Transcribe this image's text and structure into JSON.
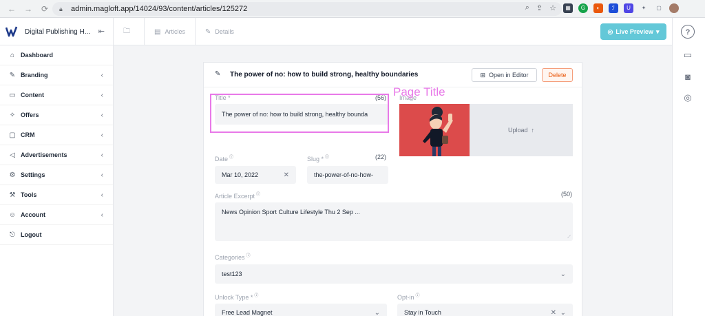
{
  "browser": {
    "url": "admin.magloft.app/14024/93/content/articles/125272",
    "nav": [
      "←",
      "→",
      "⟳"
    ],
    "extensions": [
      {
        "label": "▦",
        "color": "#374151"
      },
      {
        "label": "G",
        "color": "#16a34a"
      },
      {
        "label": "◐",
        "color": "#ea580c"
      },
      {
        "label": "ℐ",
        "color": "#1d4ed8"
      },
      {
        "label": "U",
        "color": "#4f46e5"
      },
      {
        "label": "✦",
        "color": "#6b7280"
      },
      {
        "label": "▢",
        "color": "#6b7280"
      }
    ]
  },
  "app": {
    "brand_name": "Digital Publishing H...",
    "breadcrumbs": [
      {
        "label": ""
      },
      {
        "label": "Articles"
      },
      {
        "label": "Details"
      }
    ],
    "live_preview_label": "Live Preview"
  },
  "sidebar": {
    "items": [
      {
        "label": "Dashboard",
        "icon": "⌂",
        "chevron": ""
      },
      {
        "label": "Branding",
        "icon": "✎",
        "chevron": "‹"
      },
      {
        "label": "Content",
        "icon": "▭",
        "chevron": "‹"
      },
      {
        "label": "Offers",
        "icon": "✧",
        "chevron": "‹"
      },
      {
        "label": "CRM",
        "icon": "▢",
        "chevron": "‹"
      },
      {
        "label": "Advertisements",
        "icon": "◁",
        "chevron": "‹"
      },
      {
        "label": "Settings",
        "icon": "⚙",
        "chevron": "‹"
      },
      {
        "label": "Tools",
        "icon": "⚒",
        "chevron": "‹"
      },
      {
        "label": "Account",
        "icon": "☺",
        "chevron": "‹"
      },
      {
        "label": "Logout",
        "icon": "⎋",
        "chevron": ""
      }
    ]
  },
  "article": {
    "heading": "The power of no: how to build strong, healthy boundaries",
    "open_in_editor_label": "Open in Editor",
    "delete_label": "Delete",
    "title_label": "Title *",
    "title_count": "(56)",
    "title_value": "The power of no: how to build strong, healthy bounda",
    "image_label": "Image",
    "upload_label": "Upload",
    "date_label": "Date",
    "date_value": "Mar 10, 2022",
    "slug_label": "Slug *",
    "slug_count": "(22)",
    "slug_value": "the-power-of-no-how-",
    "excerpt_label": "Article Excerpt",
    "excerpt_count": "(50)",
    "excerpt_value": "News Opinion Sport Culture Lifestyle Thu 2 Sep ...",
    "categories_label": "Categories",
    "categories_value": "test123",
    "unlock_label": "Unlock Type *",
    "unlock_value": "Free Lead Magnet",
    "optin_label": "Opt-in",
    "optin_value": "Stay in Touch"
  },
  "annotation": {
    "label": "Page Title"
  },
  "colors": {
    "accent": "#63c8d8",
    "highlight": "#e879e8",
    "delete": "#ea580c",
    "image_bg": "#dc4b4b"
  }
}
